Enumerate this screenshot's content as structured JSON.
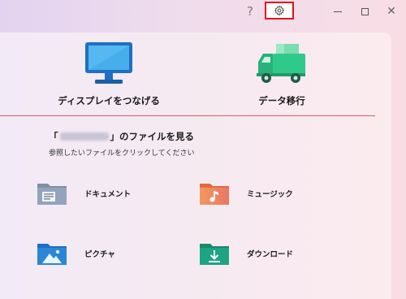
{
  "titlebar": {
    "help_label": "?",
    "settings_icon": "gear-icon",
    "minimize_icon": "minimize-icon",
    "maximize_icon": "maximize-icon",
    "close_label": "✕",
    "highlight_color": "#e0141c"
  },
  "hero": {
    "connect_display": {
      "label": "ディスプレイをつなげる",
      "icon": "monitor-icon"
    },
    "data_transfer": {
      "label": "データ移行",
      "icon": "truck-icon"
    },
    "divider_color": "#e05a62"
  },
  "source": {
    "prefix": "「",
    "suffix": "」のファイルを見る",
    "hint": "参照したいファイルをクリックしてください"
  },
  "folders": [
    {
      "label": "ドキュメント",
      "icon": "documents-folder-icon"
    },
    {
      "label": "ミュージック",
      "icon": "music-folder-icon"
    },
    {
      "label": "ピクチャ",
      "icon": "pictures-folder-icon"
    },
    {
      "label": "ダウンロード",
      "icon": "downloads-folder-icon"
    }
  ]
}
